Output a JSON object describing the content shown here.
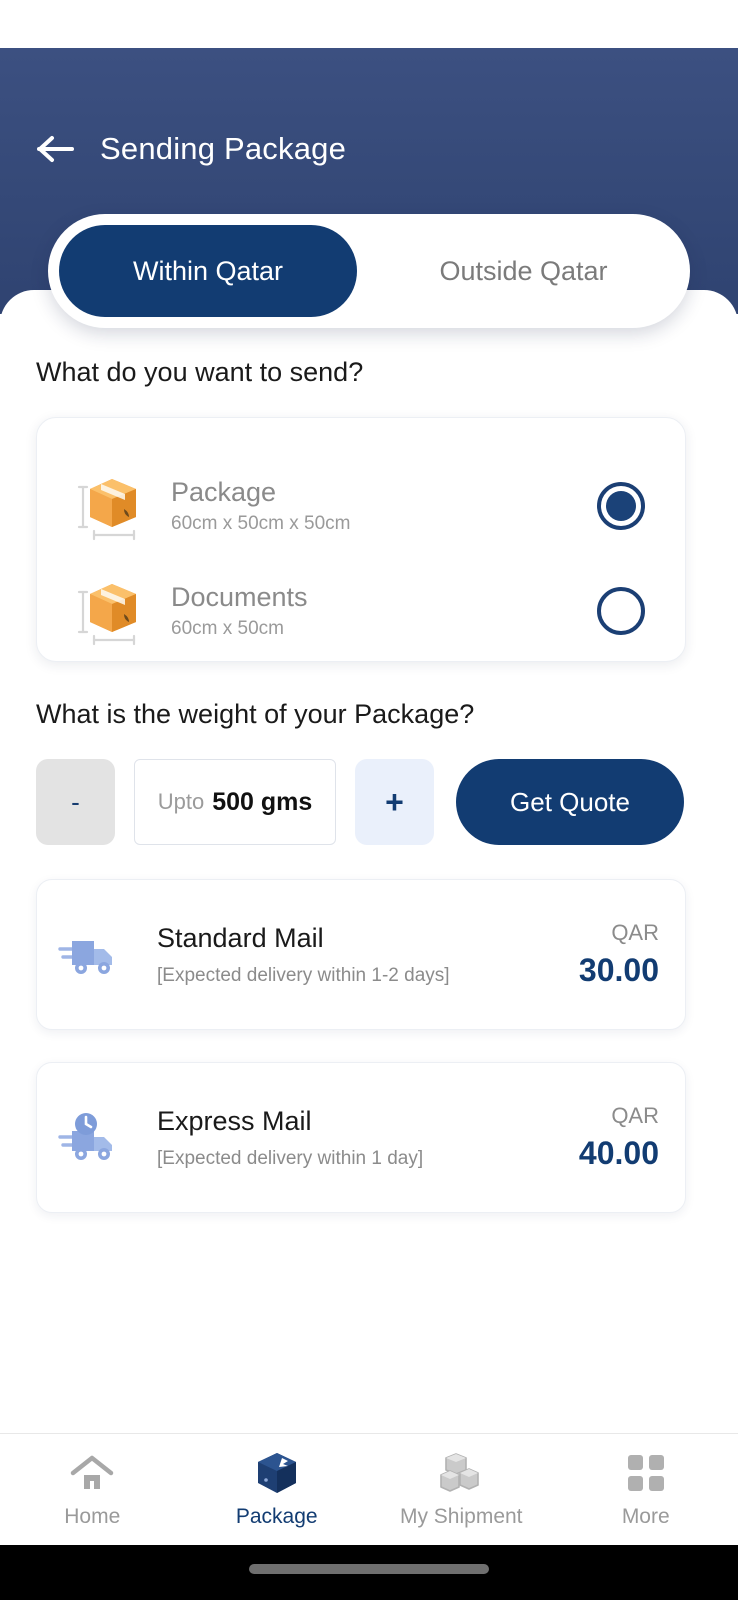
{
  "header": {
    "title": "Sending Package",
    "back_icon": "arrow-left-icon"
  },
  "tabs": [
    {
      "label": "Within Qatar",
      "active": true
    },
    {
      "label": "Outside Qatar",
      "active": false
    }
  ],
  "questions": {
    "send_type": "What do you want to send?",
    "weight": "What is the weight of your Package?"
  },
  "send_options": [
    {
      "name": "Package",
      "dimensions": "60cm x 50cm x 50cm",
      "icon": "package-box-icon",
      "selected": true
    },
    {
      "name": "Documents",
      "dimensions": "60cm x 50cm",
      "icon": "package-box-icon",
      "selected": false
    }
  ],
  "stepper": {
    "decrement_label": "-",
    "increment_label": "+",
    "weight_prefix": "Upto",
    "weight_value": "500 gms",
    "quote_button": "Get Quote"
  },
  "mail_options": [
    {
      "name": "Standard Mail",
      "eta": "[Expected delivery within 1-2 days]",
      "currency": "QAR",
      "amount": "30.00",
      "icon": "delivery-truck-icon"
    },
    {
      "name": "Express Mail",
      "eta": "[Expected delivery within 1 day]",
      "currency": "QAR",
      "amount": "40.00",
      "icon": "express-truck-icon"
    }
  ],
  "bottom_nav": [
    {
      "label": "Home",
      "icon": "home-icon",
      "active": false
    },
    {
      "label": "Package",
      "icon": "package-cube-icon",
      "active": true
    },
    {
      "label": "My Shipment",
      "icon": "boxes-icon",
      "active": false
    },
    {
      "label": "More",
      "icon": "grid-icon",
      "active": false
    }
  ],
  "colors": {
    "header_gradient_top": "#3c5081",
    "header_gradient_bottom": "#2f4371",
    "brand_navy": "#123c72",
    "accent_orange": "#f0a03c",
    "truck_blue": "#8fa9e0",
    "muted_text": "#8b8b8b"
  }
}
